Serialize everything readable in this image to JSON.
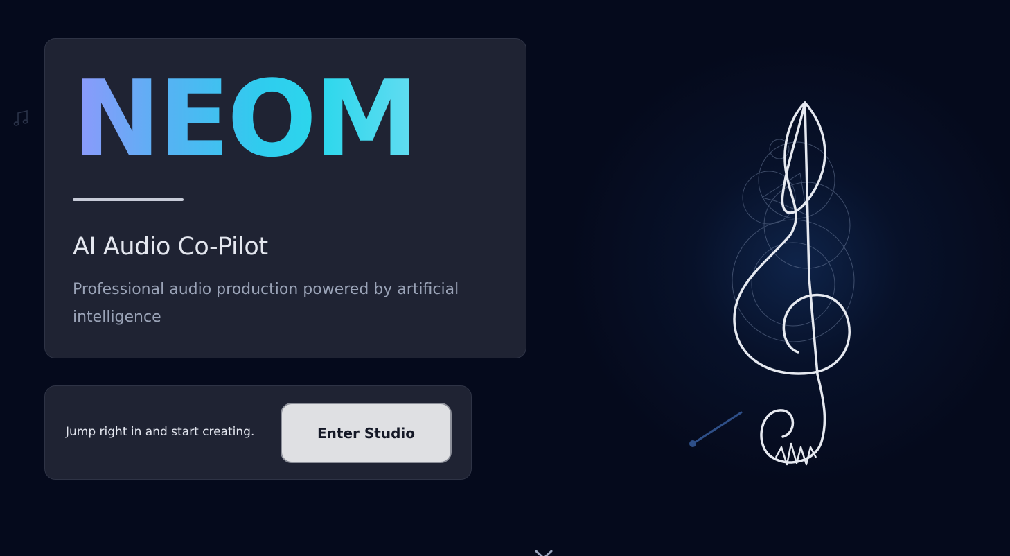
{
  "hero": {
    "brand": "NEOM",
    "subtitle": "AI Audio Co-Pilot",
    "description": "Professional audio production powered by artificial intelligence"
  },
  "cta": {
    "text": "Jump right in and start creating.",
    "button_label": "Enter Studio"
  },
  "icons": {
    "decorative_note": "music-note-icon",
    "illustration": "treble-clef-icon",
    "scroll": "chevron-down-icon"
  },
  "colors": {
    "background": "#050a1c",
    "card": "#1f2333",
    "brand_gradient": [
      "#8f98fb",
      "#2fccee",
      "#63dcf1"
    ],
    "button": "#dfe0e3"
  }
}
